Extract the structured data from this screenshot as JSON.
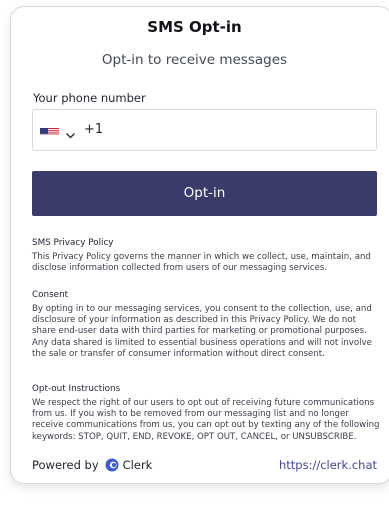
{
  "header": {
    "title": "SMS Opt-in",
    "subtitle": "Opt-in to receive messages"
  },
  "form": {
    "phone_label": "Your phone number",
    "country_flag": "us-flag-icon",
    "phone_value": "+1",
    "submit_label": "Opt-in"
  },
  "policy": {
    "privacy_heading": "SMS Privacy Policy",
    "privacy_text": "This Privacy Policy governs the manner in which we collect, use, maintain, and disclose information collected from users of our messaging services.",
    "consent_heading": "Consent",
    "consent_text": "By opting in to our messaging services, you consent to the collection, use, and disclosure of your information as described in this Privacy Policy. We do not share end-user data with third parties for marketing or promotional purposes. Any data shared is limited to essential business operations and will not involve the sale or transfer of consumer information without direct consent.",
    "optout_heading": "Opt-out Instructions",
    "optout_text": "We respect the right of our users to opt out of receiving future communications from us. If you wish to be removed from our messaging list and no longer receive communications from us, you can opt out by texting any of the following keywords: STOP, QUIT, END, REVOKE, OPT OUT, CANCEL, or UNSUBSCRIBE."
  },
  "footer": {
    "powered_by": "Powered by",
    "brand": "Clerk",
    "link": "https://clerk.chat"
  },
  "colors": {
    "button": "#393c6a",
    "link": "#3f4697",
    "brand_logo": "#3a5bd9"
  }
}
